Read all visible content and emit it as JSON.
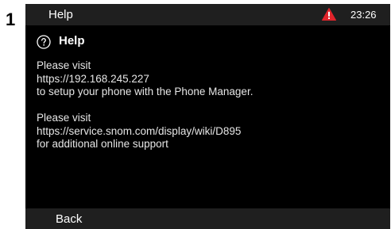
{
  "step_number": "1",
  "status_bar": {
    "title": "Help",
    "time": "23:26",
    "warning_color": "#e0242b"
  },
  "heading": {
    "icon": "help-circle-icon",
    "title": "Help"
  },
  "message": {
    "para1": {
      "line1": "Please visit",
      "line2": "https://192.168.245.227",
      "line3": "to setup your phone with the Phone Manager."
    },
    "para2": {
      "line1": "Please visit",
      "line2": "https://service.snom.com/display/wiki/D895",
      "line3": "for additional online support"
    }
  },
  "softkeys": {
    "back_label": "Back"
  }
}
